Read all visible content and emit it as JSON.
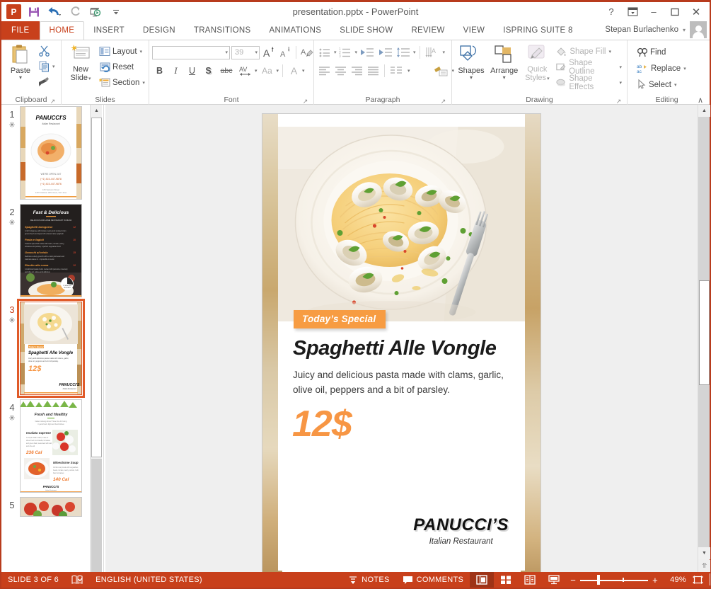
{
  "window": {
    "title": "presentation.pptx - PowerPoint",
    "help_label": "?",
    "ribbon_display_label": "ribbon-display-options",
    "minimize_label": "–",
    "restore_label": "❐",
    "close_label": "✕"
  },
  "qat": {
    "items": [
      {
        "name": "powerpoint-logo",
        "label": "P"
      },
      {
        "name": "save-icon",
        "label": "Save"
      },
      {
        "name": "undo-icon",
        "label": "Undo"
      },
      {
        "name": "redo-icon",
        "label": "Redo"
      },
      {
        "name": "start-slideshow-icon",
        "label": "Start From Beginning"
      },
      {
        "name": "customize-qat-icon",
        "label": "Customize Quick Access Toolbar"
      }
    ]
  },
  "tabs": [
    {
      "label": "FILE",
      "active": false
    },
    {
      "label": "HOME",
      "active": true
    },
    {
      "label": "INSERT",
      "active": false
    },
    {
      "label": "DESIGN",
      "active": false
    },
    {
      "label": "TRANSITIONS",
      "active": false
    },
    {
      "label": "ANIMATIONS",
      "active": false
    },
    {
      "label": "SLIDE SHOW",
      "active": false
    },
    {
      "label": "REVIEW",
      "active": false
    },
    {
      "label": "VIEW",
      "active": false
    },
    {
      "label": "ISPRING SUITE 8",
      "active": false
    }
  ],
  "account": {
    "user_name": "Stepan Burlachenko",
    "caret": "▾"
  },
  "ribbon": {
    "clipboard": {
      "label": "Clipboard",
      "paste_label": "Paste",
      "caret": "▾",
      "cut_label": "Cut",
      "copy_label": "Copy",
      "format_painter_label": "Format Painter",
      "dialog_launcher": "↗"
    },
    "slides": {
      "label": "Slides",
      "new_slide_label_line1": "New",
      "new_slide_label_line2": "Slide",
      "caret": "▾",
      "layout_label": "Layout",
      "reset_label": "Reset",
      "section_label": "Section"
    },
    "font": {
      "label": "Font",
      "font_name_value": "",
      "font_size_value": "39",
      "grow_font_label": "A",
      "shrink_font_label": "A",
      "clear_formatting_label": "Clear All Formatting",
      "bold_label": "B",
      "italic_label": "I",
      "underline_label": "U",
      "shadow_label": "S",
      "strikethrough_label": "abc",
      "char_spacing_label": "AV",
      "change_case_label": "Aa",
      "font_color_label": "A",
      "caret": "▾",
      "dialog_launcher": "↗"
    },
    "paragraph": {
      "label": "Paragraph",
      "bullets_label": "Bullets",
      "numbering_label": "Numbering",
      "decrease_indent_label": "Decrease List Level",
      "increase_indent_label": "Increase List Level",
      "line_spacing_label": "Line Spacing",
      "text_direction_label": "Text Direction",
      "align_text_label": "Align Text",
      "smartart_label": "Convert to SmartArt",
      "align_left_label": "Align Left",
      "align_center_label": "Center",
      "align_right_label": "Align Right",
      "justify_label": "Justify",
      "columns_label": "Columns",
      "caret": "▾",
      "dialog_launcher": "↗"
    },
    "drawing": {
      "label": "Drawing",
      "shapes_label": "Shapes",
      "arrange_label": "Arrange",
      "quick_styles_line1": "Quick",
      "quick_styles_line2": "Styles",
      "shape_fill_label": "Shape Fill",
      "shape_outline_label": "Shape Outline",
      "shape_effects_label": "Shape Effects",
      "caret": "▾",
      "dialog_launcher": "↗"
    },
    "editing": {
      "label": "Editing",
      "find_label": "Find",
      "replace_label": "Replace",
      "select_label": "Select",
      "caret": "▾",
      "collapse_ribbon": "∧"
    }
  },
  "thumbnails": {
    "selected_index": 3,
    "items": [
      {
        "number": "1",
        "star": "✳",
        "kind": "cover",
        "selected": false
      },
      {
        "number": "2",
        "star": "✳",
        "kind": "dark-menu",
        "selected": false
      },
      {
        "number": "3",
        "star": "✳",
        "kind": "special",
        "selected": true
      },
      {
        "number": "4",
        "star": "✳",
        "kind": "healthy",
        "selected": false
      },
      {
        "number": "5",
        "star": "",
        "kind": "partial",
        "selected": false
      }
    ],
    "scroll_up": "▲",
    "scroll_down": "▼"
  },
  "slide": {
    "badge": "Today’s Special",
    "title": "Spaghetti Alle Vongle",
    "description_line1": "Juicy and delicious pasta made with clams, garlic,",
    "description_line2": "olive oil, peppers and a bit of parsley.",
    "price": "12$",
    "logo_name": "PANUCCI’S",
    "logo_tagline": "Italian Restaurant",
    "photo_alt": "spaghetti-with-clams-photo",
    "colors": {
      "accent_orange": "#f79c42",
      "price_orange": "#f79644",
      "bottom_bar": "#f2a04a"
    }
  },
  "pane_scroll": {
    "up_arrow": "▲",
    "down_arrow": "▼",
    "prev_slide": "⥣",
    "next_slide": "⥤"
  },
  "statusbar": {
    "slide_indicator": "SLIDE 3 OF 6",
    "spellcheck_label": "spell-check",
    "language": "ENGLISH (UNITED STATES)",
    "notes_label": "NOTES",
    "comments_label": "COMMENTS",
    "view_normal_label": "Normal View",
    "view_sorter_label": "Slide Sorter",
    "view_reading_label": "Reading View",
    "view_slideshow_label": "Slide Show",
    "zoom_out": "−",
    "zoom_in": "+",
    "zoom_value": "49%",
    "fit_slide_label": "Fit slide to current window",
    "accent_color": "#c8401b"
  }
}
